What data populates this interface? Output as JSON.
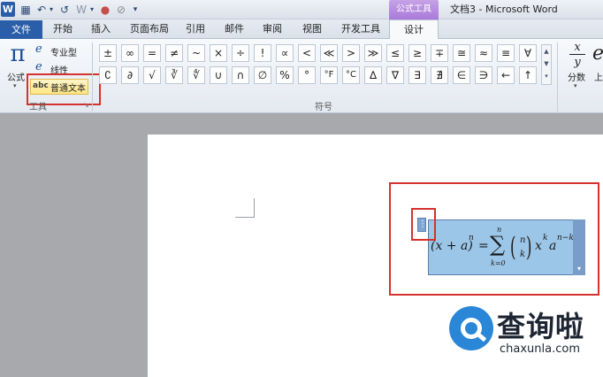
{
  "window": {
    "title": "文档3 - Microsoft Word",
    "context_tab_header": "公式工具"
  },
  "quick_access": {
    "app_icon": "W",
    "icons": [
      "save-icon",
      "undo-icon",
      "dropdown-arrow-icon",
      "redo-icon",
      "repeat-icon",
      "color-icon",
      "no-format-icon",
      "customize-icon"
    ]
  },
  "tabs": [
    "文件",
    "开始",
    "插入",
    "页面布局",
    "引用",
    "邮件",
    "审阅",
    "视图",
    "开发工具",
    "设计"
  ],
  "ribbon": {
    "tools": {
      "formula_symbol": "π",
      "formula_label": "公式",
      "professional_icon": "e",
      "professional_label": "专业型",
      "linear_icon": "e",
      "linear_label": "线性",
      "plain_abc": "abc",
      "plain_label": "普通文本",
      "group_label": "工具"
    },
    "symbols": {
      "row1": [
        "±",
        "∞",
        "=",
        "≠",
        "~",
        "×",
        "÷",
        "!",
        "∝",
        "<",
        "≪",
        ">",
        "≫",
        "≤",
        "≥",
        "∓",
        "≅",
        "≈",
        "≡",
        "∀"
      ],
      "row2": [
        "∁",
        "∂",
        "√",
        "∛",
        "∜",
        "∪",
        "∩",
        "∅",
        "%",
        "°",
        "°F",
        "°C",
        "∆",
        "∇",
        "∃",
        "∄",
        "∈",
        "∋",
        "←",
        "↑"
      ],
      "group_label": "符号"
    },
    "structures": {
      "fraction_num": "x",
      "fraction_den": "y",
      "fraction_label": "分数",
      "script_icon": "e",
      "script_label": "上"
    }
  },
  "equation": {
    "lhs": "(x + a)",
    "lhs_exp": "n",
    "equals": "=",
    "sum_top": "n",
    "sum": "∑",
    "sum_bottom": "k=0",
    "binom_top": "n",
    "binom_bottom": "k",
    "term": "x",
    "term_exp": "k",
    "term2": "a",
    "term2_exp": "n−k"
  },
  "watermark": {
    "chinese": "查询啦",
    "url": "chaxunla.com"
  }
}
